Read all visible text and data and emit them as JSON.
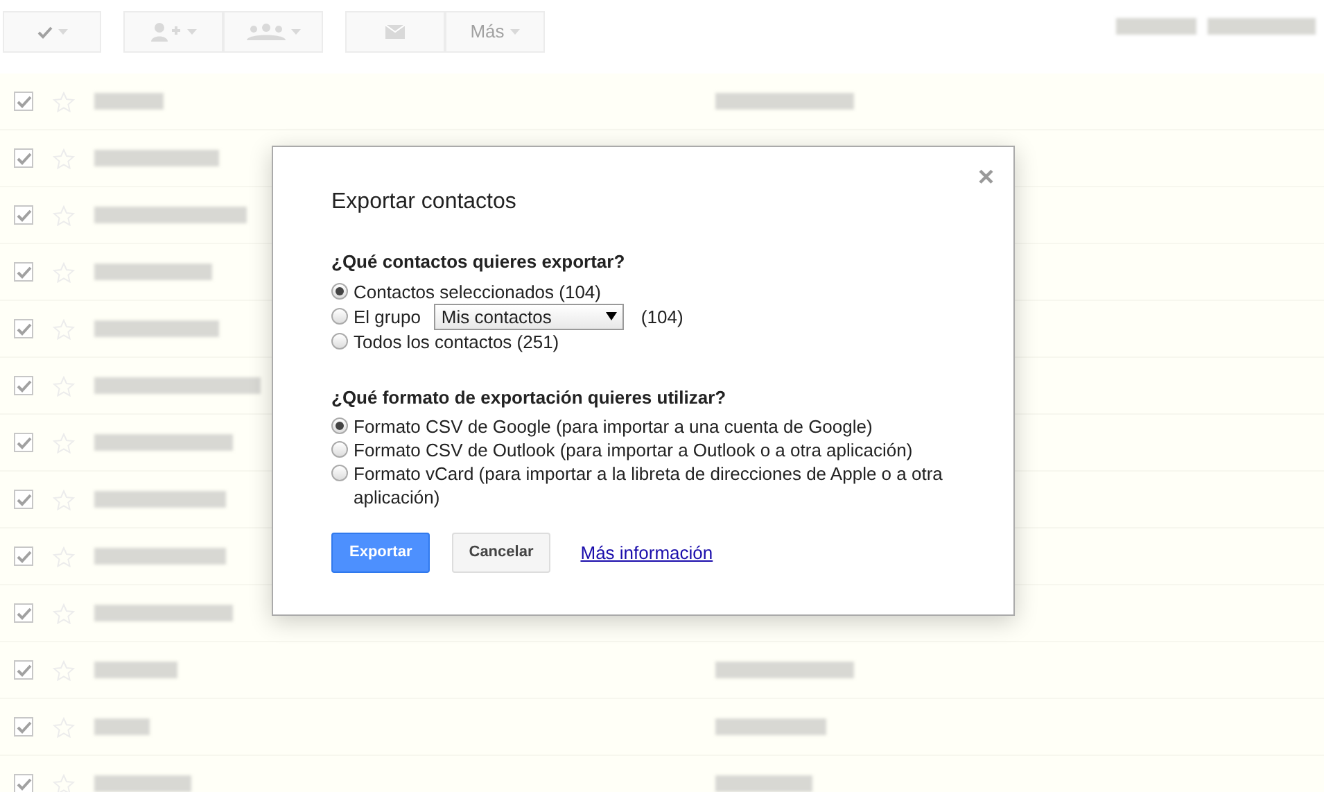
{
  "toolbar": {
    "select_checked": true,
    "more_label": "Más"
  },
  "contact_rows": [
    {
      "checked": true,
      "starred": false
    },
    {
      "checked": true,
      "starred": false
    },
    {
      "checked": true,
      "starred": false
    },
    {
      "checked": true,
      "starred": false
    },
    {
      "checked": true,
      "starred": false
    },
    {
      "checked": true,
      "starred": false
    },
    {
      "checked": true,
      "starred": false
    },
    {
      "checked": true,
      "starred": false
    },
    {
      "checked": true,
      "starred": false
    },
    {
      "checked": true,
      "starred": false
    },
    {
      "checked": true,
      "starred": false
    },
    {
      "checked": true,
      "starred": false
    },
    {
      "checked": true,
      "starred": false
    }
  ],
  "dialog": {
    "title": "Exportar contactos",
    "close_icon": "×",
    "contacts_question": "¿Qué contactos quieres exportar?",
    "contacts_options": [
      {
        "kind": "plain",
        "label": "Contactos seleccionados (104)",
        "selected": true
      },
      {
        "kind": "group",
        "label": "El grupo",
        "value": "Mis contactos",
        "count": "(104)",
        "selected": false
      },
      {
        "kind": "plain",
        "label": "Todos los contactos (251)",
        "selected": false
      }
    ],
    "format_question": "¿Qué formato de exportación quieres utilizar?",
    "format_options": [
      {
        "label": "Formato CSV de Google (para importar a una cuenta de Google)",
        "selected": true
      },
      {
        "label": "Formato CSV de Outlook (para importar a Outlook o a otra aplicación)",
        "selected": false
      },
      {
        "label": "Formato vCard (para importar a la libreta de direcciones de Apple o a otra aplicación)",
        "selected": false
      }
    ],
    "export_button": "Exportar",
    "cancel_button": "Cancelar",
    "more_info_link": "Más información"
  }
}
